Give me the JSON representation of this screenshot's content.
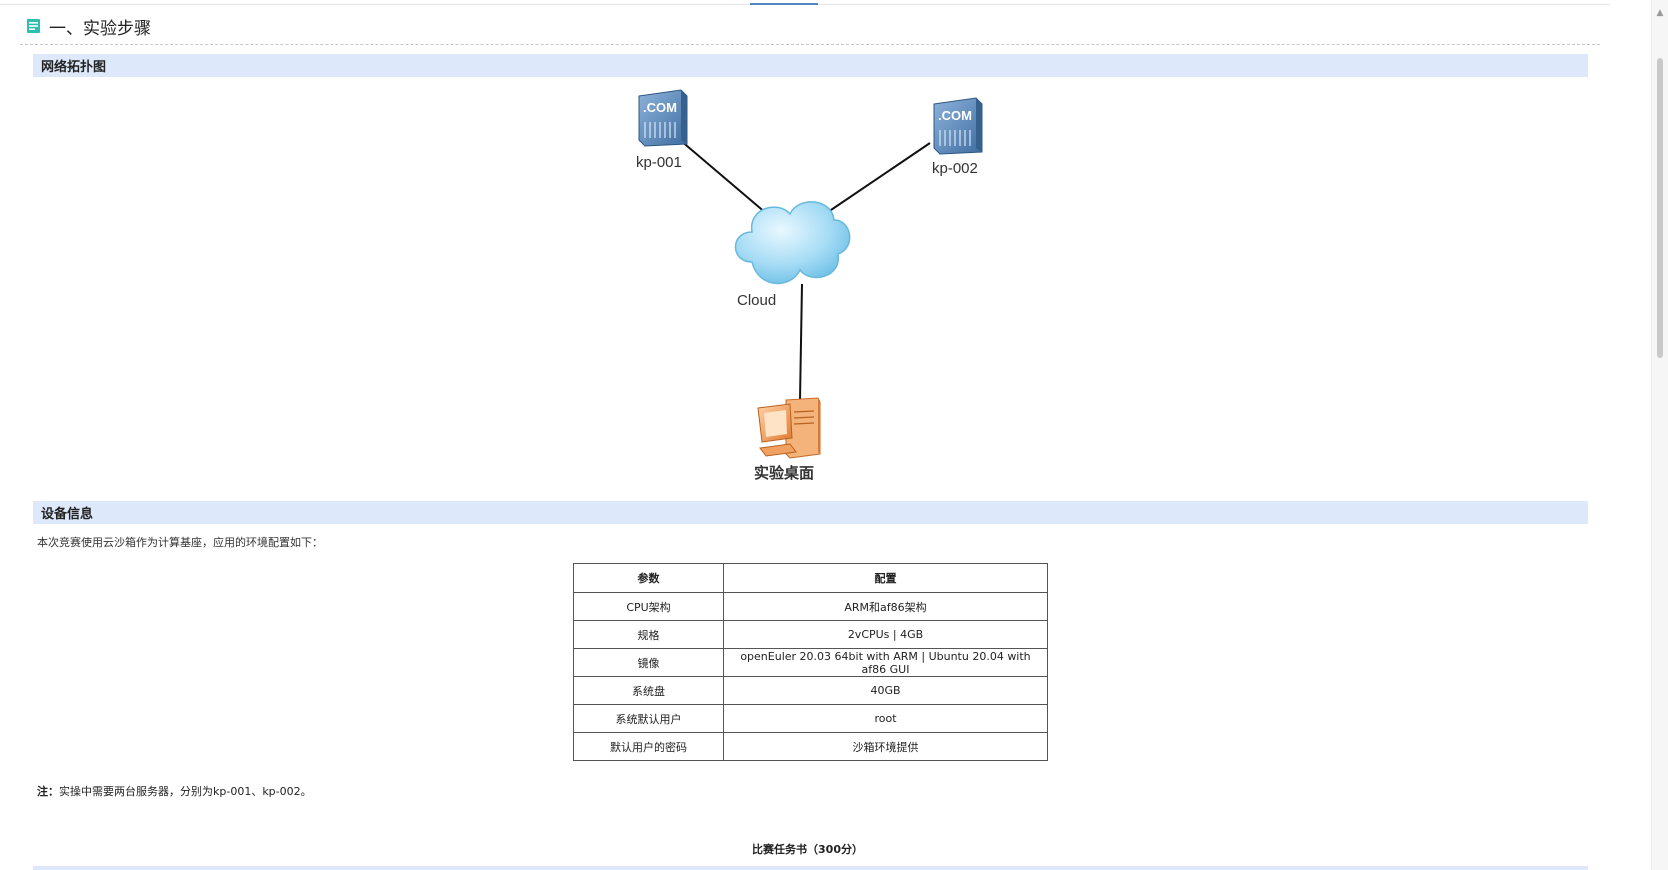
{
  "heading": {
    "title": "一、实验步骤"
  },
  "sections": {
    "topology": "网络拓扑图",
    "device_info": "设备信息"
  },
  "diagram": {
    "nodes": [
      {
        "label": "kp-001",
        "icon": "server-icon",
        "badge": ".COM"
      },
      {
        "label": "kp-002",
        "icon": "server-icon",
        "badge": ".COM"
      },
      {
        "label": "Cloud",
        "icon": "cloud-icon"
      },
      {
        "label": "实验桌面",
        "icon": "desktop-computer-icon"
      }
    ]
  },
  "intro": "本次竞赛使用云沙箱作为计算基座，应用的环境配置如下：",
  "table": {
    "headers": [
      "参数",
      "配置"
    ],
    "rows": [
      [
        "CPU架构",
        "ARM和af86架构"
      ],
      [
        "规格",
        "2vCPUs | 4GB"
      ],
      [
        "镜像",
        "openEuler 20.03 64bit with ARM | Ubuntu 20.04 with af86 GUI"
      ],
      [
        "系统盘",
        "40GB"
      ],
      [
        "系统默认用户",
        "root"
      ],
      [
        "默认用户的密码",
        "沙箱环境提供"
      ]
    ]
  },
  "note": {
    "prefix": "注：",
    "text": "实操中需要两台服务器，分别为kp-001、kp-002。"
  },
  "task_title": "比赛任务书（300分）",
  "colors": {
    "section_bar": "#dde9fb",
    "server_blue": "#5b86b6",
    "cloud_blue": "#9fd9f4",
    "desktop_orange": "#f0a060",
    "heading_icon": "#2fbfb0"
  }
}
